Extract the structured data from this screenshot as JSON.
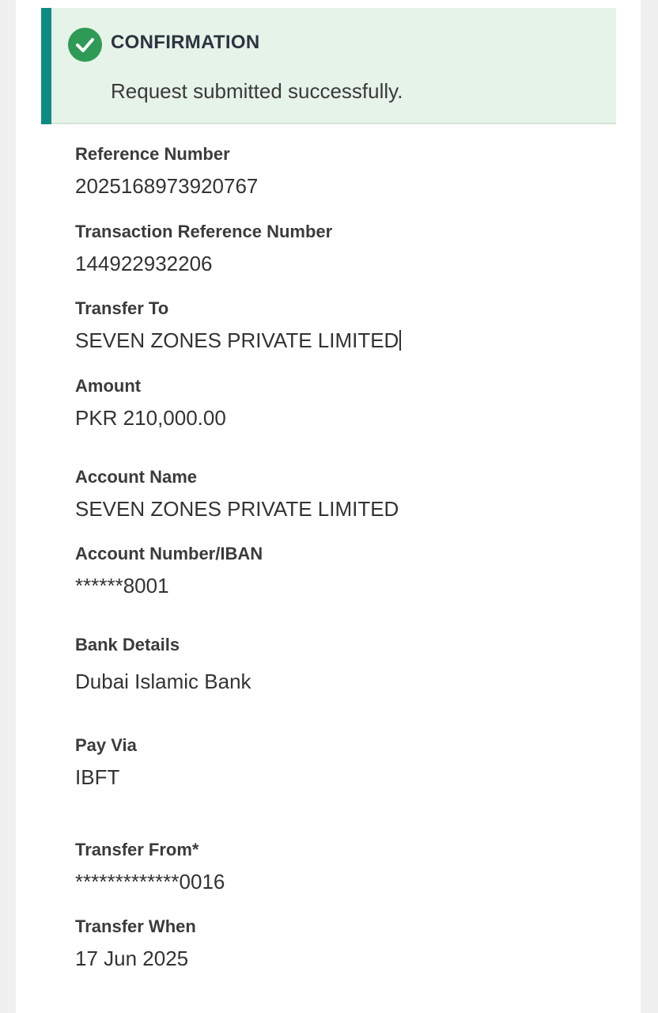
{
  "confirmation": {
    "title": "CONFIRMATION",
    "message": "Request submitted successfully.",
    "icon": "check-circle-icon",
    "accent_color": "#0e8a86",
    "icon_color": "#2e9a55",
    "background_color": "#e6f3e8"
  },
  "fields": {
    "reference_number": {
      "label": "Reference Number",
      "value": "2025168973920767"
    },
    "transaction_reference_number": {
      "label": "Transaction Reference Number",
      "value": "144922932206"
    },
    "transfer_to": {
      "label": "Transfer To",
      "value": "SEVEN ZONES PRIVATE LIMITED"
    },
    "amount": {
      "label": "Amount",
      "value": "PKR 210,000.00"
    },
    "account_name": {
      "label": "Account Name",
      "value": "SEVEN ZONES PRIVATE LIMITED"
    },
    "account_number": {
      "label": "Account Number/IBAN",
      "value": "******8001"
    },
    "bank_details": {
      "label": "Bank Details",
      "value": "Dubai Islamic Bank"
    },
    "pay_via": {
      "label": "Pay Via",
      "value": "IBFT"
    },
    "transfer_from": {
      "label": "Transfer From*",
      "value": "*************0016"
    },
    "transfer_when": {
      "label": "Transfer When",
      "value": "17 Jun 2025"
    }
  }
}
